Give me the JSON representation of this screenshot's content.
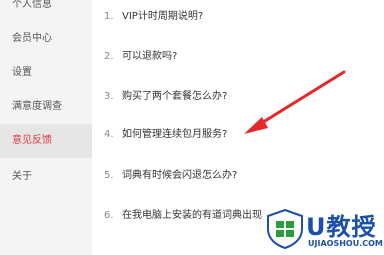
{
  "sidebar": {
    "items": [
      {
        "label": "个人信息"
      },
      {
        "label": "会员中心"
      },
      {
        "label": "设置"
      },
      {
        "label": "满意度调查"
      },
      {
        "label": "意见反馈",
        "active": true
      },
      {
        "label": "关于"
      }
    ]
  },
  "faq": {
    "items": [
      {
        "num": "1.",
        "text": "VIP计时周期说明?"
      },
      {
        "num": "2.",
        "text": "可以退款吗?"
      },
      {
        "num": "3.",
        "text": "购买了两个套餐怎么办?"
      },
      {
        "num": "4.",
        "text": "如何管理连续包月服务?"
      },
      {
        "num": "5.",
        "text": "词典有时候会闪退怎么办?"
      },
      {
        "num": "6.",
        "text": "在我电脑上安装的有道词典出现"
      }
    ]
  },
  "watermark": {
    "title": "U教授",
    "url": "UJIAOSHOU.COM"
  },
  "colors": {
    "accent": "#e03a3e",
    "arrow": "#e8262a",
    "watermark": "#1b4fa8",
    "sidebar_bg": "#f4f4f4",
    "sidebar_active_bg": "#e6e6e6"
  }
}
